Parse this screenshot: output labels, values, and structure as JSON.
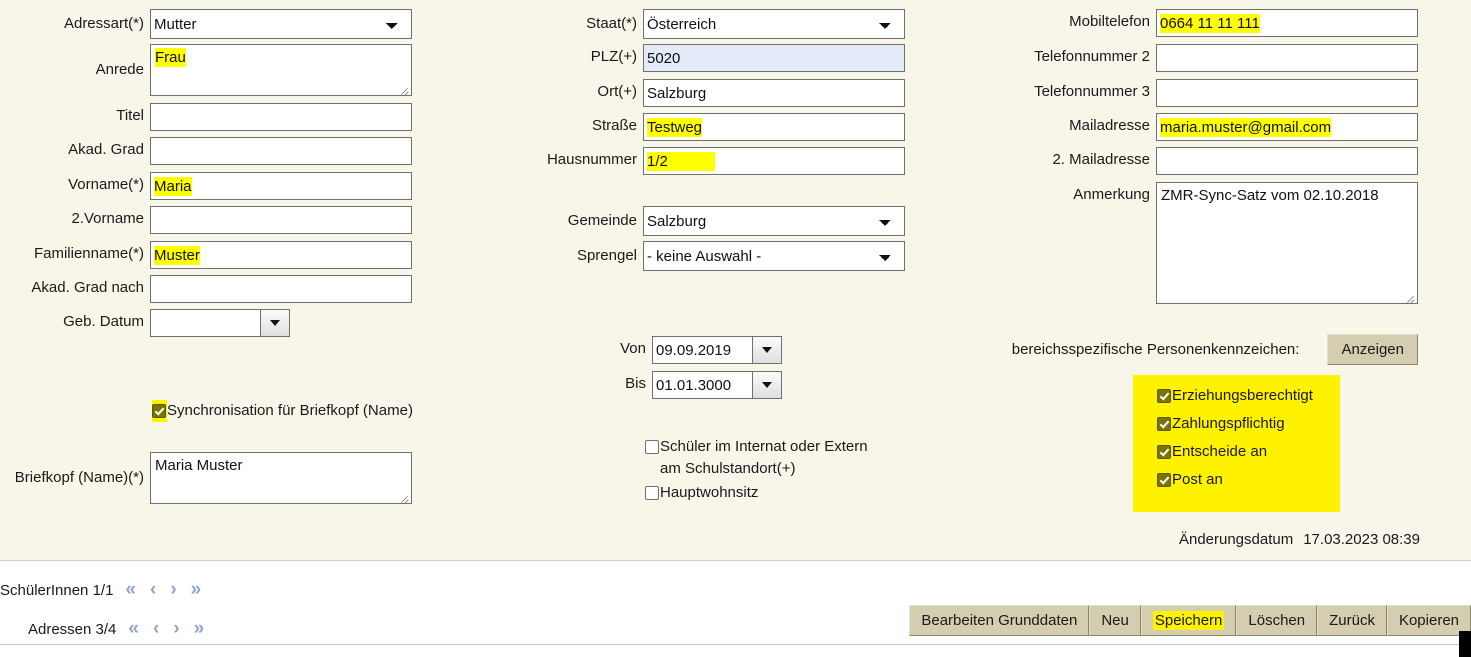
{
  "left_column": {
    "fields": [
      {
        "label": "Adressart(*)",
        "type": "select",
        "value": "Mutter",
        "highlight": false
      },
      {
        "label": "Anrede",
        "type": "textarea",
        "value": "Frau",
        "highlight": true
      },
      {
        "label": "Titel",
        "type": "text",
        "value": "",
        "highlight": false
      },
      {
        "label": "Akad. Grad",
        "type": "text",
        "value": "",
        "highlight": false
      },
      {
        "label": "Vorname(*)",
        "type": "text",
        "value": "Maria",
        "highlight": true
      },
      {
        "label": "2.Vorname",
        "type": "text",
        "value": "",
        "highlight": false
      },
      {
        "label": "Familienname(*)",
        "type": "text",
        "value": "Muster",
        "highlight": true
      },
      {
        "label": "Akad. Grad nach",
        "type": "text",
        "value": "",
        "highlight": false
      },
      {
        "label": "Geb. Datum",
        "type": "date",
        "value": "",
        "highlight": false
      }
    ],
    "sync_checkbox": {
      "label": "Synchronisation für Briefkopf (Name)",
      "checked": true,
      "highlight": true
    },
    "briefkopf": {
      "label": "Briefkopf (Name)(*)",
      "value": "Maria Muster"
    }
  },
  "middle_column": {
    "fields": [
      {
        "label": "Staat(*)",
        "type": "select",
        "value": "Österreich",
        "highlight": false
      },
      {
        "label": "PLZ(+)",
        "type": "text",
        "value": "5020",
        "highlight": false,
        "focused": true
      },
      {
        "label": "Ort(+)",
        "type": "text",
        "value": "Salzburg",
        "highlight": false
      },
      {
        "label": "Straße",
        "type": "text",
        "value": "Testweg",
        "highlight": true
      },
      {
        "label": "Hausnummer",
        "type": "text",
        "value": "1/2",
        "highlight": true
      }
    ],
    "fields2": [
      {
        "label": "Gemeinde",
        "type": "select",
        "value": "Salzburg"
      },
      {
        "label": "Sprengel",
        "type": "select",
        "value": "- keine Auswahl -"
      }
    ],
    "dates": [
      {
        "label": "Von",
        "value": "09.09.2019"
      },
      {
        "label": "Bis",
        "value": "01.01.3000"
      }
    ],
    "checkboxes": [
      {
        "label": "Schüler im Internat oder Extern am Schulstandort(+)",
        "checked": false
      },
      {
        "label": "Hauptwohnsitz",
        "checked": false
      }
    ]
  },
  "right_column": {
    "fields": [
      {
        "label": "Mobiltelefon",
        "type": "text",
        "value": "0664 11 11 111",
        "highlight": true
      },
      {
        "label": "Telefonnummer 2",
        "type": "text",
        "value": "",
        "highlight": false
      },
      {
        "label": "Telefonnummer 3",
        "type": "text",
        "value": "",
        "highlight": false
      },
      {
        "label": "Mailadresse",
        "type": "text",
        "value": "maria.muster@gmail.com",
        "highlight": true
      },
      {
        "label": "2. Mailadresse",
        "type": "text",
        "value": "",
        "highlight": false
      }
    ],
    "anmerkung": {
      "label": "Anmerkung",
      "value": "ZMR-Sync-Satz vom 02.10.2018"
    },
    "bpk": {
      "label": "bereichsspezifische Personenkennzeichen:",
      "button": "Anzeigen"
    },
    "role_checkboxes": [
      {
        "label": "Erziehungsberechtigt",
        "checked": true
      },
      {
        "label": "Zahlungspflichtig",
        "checked": true
      },
      {
        "label": "Entscheide an",
        "checked": true
      },
      {
        "label": "Post an",
        "checked": true
      }
    ],
    "changed": {
      "label": "Änderungsdatum",
      "value": "17.03.2023 08:39"
    }
  },
  "footer": {
    "pagers": [
      {
        "label": "SchülerInnen 1/1",
        "first": "«",
        "prev": "‹",
        "next": "›",
        "last": "»"
      },
      {
        "label": "Adressen 3/4",
        "first": "«",
        "prev": "‹",
        "next": "›",
        "last": "»"
      }
    ],
    "buttons": [
      {
        "label": "Bearbeiten Grunddaten",
        "highlight": false
      },
      {
        "label": "Neu",
        "highlight": false
      },
      {
        "label": "Speichern",
        "highlight": true
      },
      {
        "label": "Löschen",
        "highlight": false
      },
      {
        "label": "Zurück",
        "highlight": false
      },
      {
        "label": "Kopieren",
        "highlight": false
      }
    ]
  },
  "colors": {
    "background": "#F8F5E9",
    "highlight": "#FFFF00",
    "yellow_block": "#FFF200",
    "button": "#D5CDB0",
    "focus_field": "#E3EAF8",
    "nav_arrow": "#8FA4CC"
  }
}
